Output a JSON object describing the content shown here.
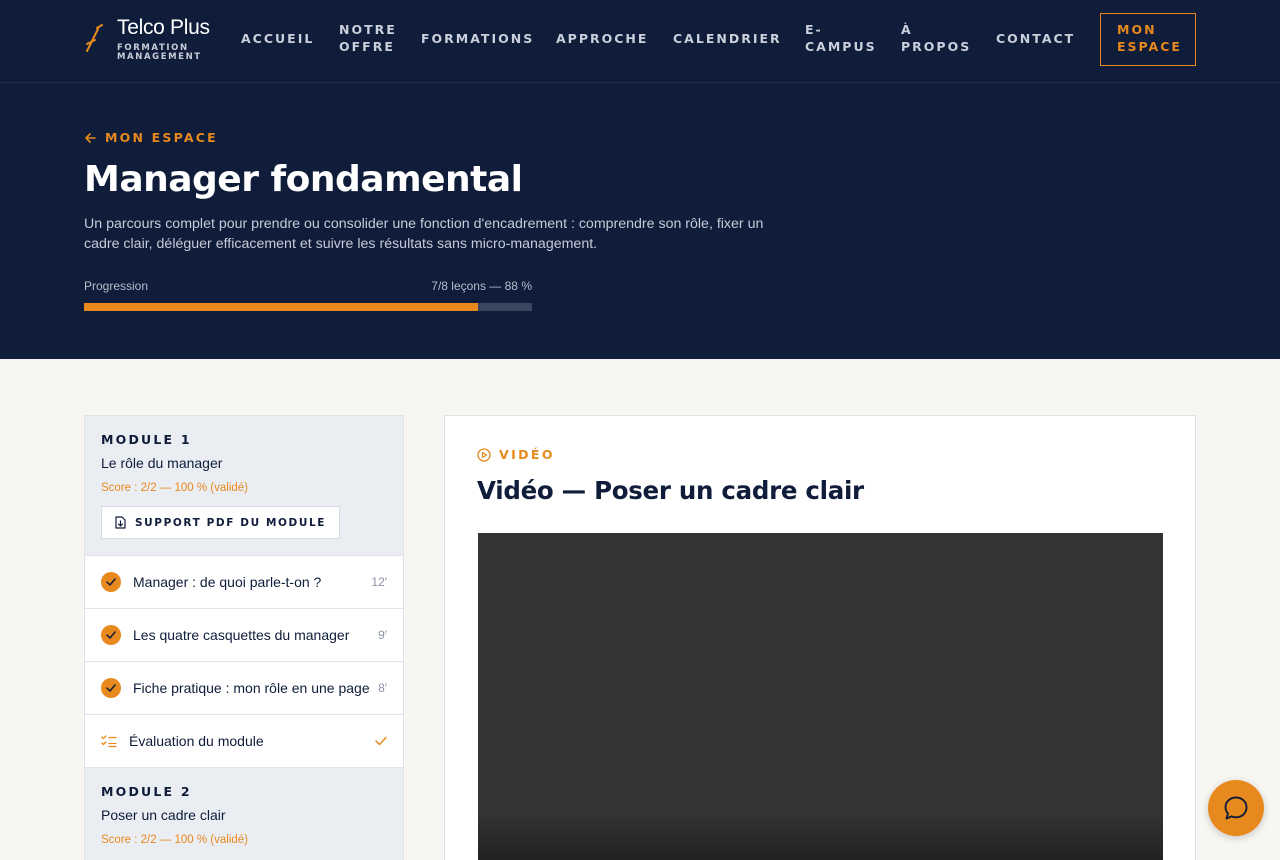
{
  "header": {
    "brand": "Telco Plus",
    "tagline": [
      "FORMATION",
      "MANAGEMENT"
    ],
    "nav": [
      {
        "label": "ACCUEIL"
      },
      {
        "label": "NOTRE OFFRE"
      },
      {
        "label": "FORMATIONS"
      },
      {
        "label": "APPROCHE"
      },
      {
        "label": "CALENDRIER"
      },
      {
        "label": "E-CAMPUS"
      },
      {
        "label": "À PROPOS"
      },
      {
        "label": "CONTACT"
      }
    ],
    "cta": "MON ESPACE"
  },
  "hero": {
    "back_label": "MON ESPACE",
    "title": "Manager fondamental",
    "lead": "Un parcours complet pour prendre ou consolider une fonction d'encadrement : comprendre son rôle, fixer un cadre clair, déléguer efficacement et suivre les résultats sans micro-management.",
    "progress_label": "Progression",
    "progress_value": "7/8 leçons — 88 %",
    "progress_fraction": 0.88
  },
  "sidebar": {
    "modules": [
      {
        "number": "MODULE 1",
        "title": "Le rôle du manager",
        "score": "Score : 2/2 — 100 % (validé)",
        "pdf_label": "SUPPORT PDF DU MODULE",
        "lessons": [
          {
            "title": "Manager : de quoi parle-t-on ?",
            "duration": "12′",
            "done": true
          },
          {
            "title": "Les quatre casquettes du manager",
            "duration": "9′",
            "done": true
          },
          {
            "title": "Fiche pratique : mon rôle en une page",
            "duration": "8′",
            "done": true
          }
        ],
        "quiz": {
          "title": "Évaluation du module",
          "done": true
        }
      },
      {
        "number": "MODULE 2",
        "title": "Poser un cadre clair",
        "score": "Score : 2/2 — 100 % (validé)"
      }
    ]
  },
  "content": {
    "kind": "VIDÉO",
    "title": "Vidéo — Poser un cadre clair"
  },
  "colors": {
    "navy": "#0f1c3a",
    "accent": "#e8891d",
    "background": "#f8f6f3"
  },
  "icons": {
    "back": "arrow-left-icon",
    "pdf": "file-download-icon",
    "check": "check-icon",
    "quiz": "checklist-icon",
    "video": "play-circle-icon",
    "chat": "chat-bubble-icon"
  }
}
